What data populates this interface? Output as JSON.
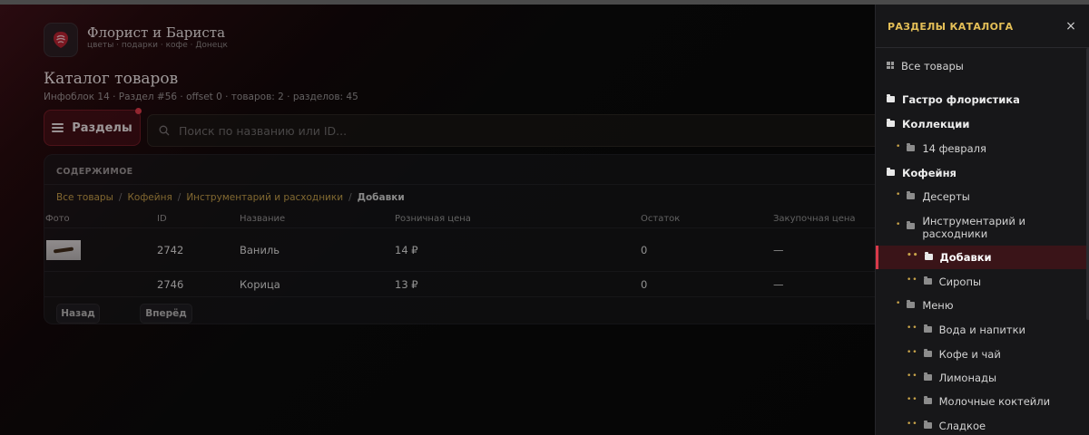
{
  "brand": {
    "title": "Флорист и Бариста",
    "subtitle": "цветы · подарки · кофе · Донецк",
    "logo_icon": "rose-icon"
  },
  "page": {
    "title": "Каталог товаров",
    "meta": "Инфоблок 14 · Раздел #56 · offset 0 · товаров: 2 · разделов: 45"
  },
  "toolbar": {
    "sections_label": "Разделы",
    "search_placeholder": "Поиск по названию или ID..."
  },
  "panel": {
    "heading": "СОДЕРЖИМОЕ",
    "breadcrumbs": [
      "Все товары",
      "Кофейня",
      "Инструментарий и расходники"
    ],
    "breadcrumb_current": "Добавки",
    "columns": [
      "Фото",
      "ID",
      "Название",
      "Розничная цена",
      "Остаток",
      "Закупочная цена"
    ],
    "rows": [
      {
        "id": "2742",
        "name": "Ваниль",
        "price": "14 ₽",
        "stock": "0",
        "cost": "—",
        "has_photo": true
      },
      {
        "id": "2746",
        "name": "Корица",
        "price": "13 ₽",
        "stock": "0",
        "cost": "—",
        "has_photo": false
      }
    ],
    "prev_label": "Назад",
    "next_label": "Вперёд"
  },
  "drawer": {
    "title": "РАЗДЕЛЫ КАТАЛОГА",
    "close_label": "×",
    "items": [
      {
        "label": "Все товары",
        "level": 0,
        "icon": "grid-icon"
      },
      {
        "label": "Гастро флористика",
        "level": 0,
        "icon": "folder-icon"
      },
      {
        "label": "Коллекции",
        "level": 0,
        "icon": "folder-icon"
      },
      {
        "label": "14 февраля",
        "level": 1,
        "icon": "folder-icon"
      },
      {
        "label": "Кофейня",
        "level": 0,
        "icon": "folder-icon"
      },
      {
        "label": "Десерты",
        "level": 1,
        "icon": "folder-icon"
      },
      {
        "label": "Инструментарий и расходники",
        "level": 1,
        "icon": "folder-icon"
      },
      {
        "label": "Добавки",
        "level": 2,
        "icon": "folder-icon",
        "active": true
      },
      {
        "label": "Сиропы",
        "level": 2,
        "icon": "folder-icon"
      },
      {
        "label": "Меню",
        "level": 1,
        "icon": "folder-icon"
      },
      {
        "label": "Вода и напитки",
        "level": 2,
        "icon": "folder-icon"
      },
      {
        "label": "Кофе и чай",
        "level": 2,
        "icon": "folder-icon"
      },
      {
        "label": "Лимонады",
        "level": 2,
        "icon": "folder-icon"
      },
      {
        "label": "Молочные коктейли",
        "level": 2,
        "icon": "folder-icon"
      },
      {
        "label": "Сладкое",
        "level": 2,
        "icon": "folder-icon"
      }
    ]
  },
  "colors": {
    "accent_gold": "#e4bf57",
    "accent_red": "#d83a4a",
    "breadcrumb": "#c9a44a"
  }
}
